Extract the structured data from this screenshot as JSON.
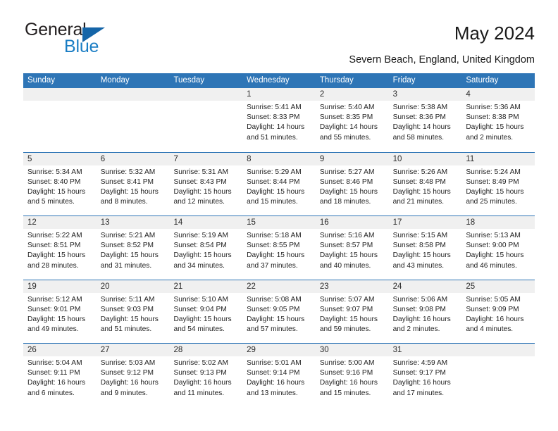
{
  "brand": {
    "name_top": "General",
    "name_bottom": "Blue",
    "accent_color": "#1a7dc4",
    "triangle_color": "#1565a8"
  },
  "header": {
    "title": "May 2024",
    "subtitle": "Severn Beach, England, United Kingdom"
  },
  "theme": {
    "header_blue": "#2e75b6",
    "daynum_band": "#f0f0f0",
    "text": "#222222"
  },
  "calendar": {
    "weekdays": [
      "Sunday",
      "Monday",
      "Tuesday",
      "Wednesday",
      "Thursday",
      "Friday",
      "Saturday"
    ],
    "weeks": [
      [
        {
          "day": "",
          "empty": true,
          "sunrise": "",
          "sunset": "",
          "daylight_line1": "",
          "daylight_line2": ""
        },
        {
          "day": "",
          "empty": true,
          "sunrise": "",
          "sunset": "",
          "daylight_line1": "",
          "daylight_line2": ""
        },
        {
          "day": "",
          "empty": true,
          "sunrise": "",
          "sunset": "",
          "daylight_line1": "",
          "daylight_line2": ""
        },
        {
          "day": "1",
          "empty": false,
          "sunrise": "Sunrise: 5:41 AM",
          "sunset": "Sunset: 8:33 PM",
          "daylight_line1": "Daylight: 14 hours",
          "daylight_line2": "and 51 minutes."
        },
        {
          "day": "2",
          "empty": false,
          "sunrise": "Sunrise: 5:40 AM",
          "sunset": "Sunset: 8:35 PM",
          "daylight_line1": "Daylight: 14 hours",
          "daylight_line2": "and 55 minutes."
        },
        {
          "day": "3",
          "empty": false,
          "sunrise": "Sunrise: 5:38 AM",
          "sunset": "Sunset: 8:36 PM",
          "daylight_line1": "Daylight: 14 hours",
          "daylight_line2": "and 58 minutes."
        },
        {
          "day": "4",
          "empty": false,
          "sunrise": "Sunrise: 5:36 AM",
          "sunset": "Sunset: 8:38 PM",
          "daylight_line1": "Daylight: 15 hours",
          "daylight_line2": "and 2 minutes."
        }
      ],
      [
        {
          "day": "5",
          "empty": false,
          "sunrise": "Sunrise: 5:34 AM",
          "sunset": "Sunset: 8:40 PM",
          "daylight_line1": "Daylight: 15 hours",
          "daylight_line2": "and 5 minutes."
        },
        {
          "day": "6",
          "empty": false,
          "sunrise": "Sunrise: 5:32 AM",
          "sunset": "Sunset: 8:41 PM",
          "daylight_line1": "Daylight: 15 hours",
          "daylight_line2": "and 8 minutes."
        },
        {
          "day": "7",
          "empty": false,
          "sunrise": "Sunrise: 5:31 AM",
          "sunset": "Sunset: 8:43 PM",
          "daylight_line1": "Daylight: 15 hours",
          "daylight_line2": "and 12 minutes."
        },
        {
          "day": "8",
          "empty": false,
          "sunrise": "Sunrise: 5:29 AM",
          "sunset": "Sunset: 8:44 PM",
          "daylight_line1": "Daylight: 15 hours",
          "daylight_line2": "and 15 minutes."
        },
        {
          "day": "9",
          "empty": false,
          "sunrise": "Sunrise: 5:27 AM",
          "sunset": "Sunset: 8:46 PM",
          "daylight_line1": "Daylight: 15 hours",
          "daylight_line2": "and 18 minutes."
        },
        {
          "day": "10",
          "empty": false,
          "sunrise": "Sunrise: 5:26 AM",
          "sunset": "Sunset: 8:48 PM",
          "daylight_line1": "Daylight: 15 hours",
          "daylight_line2": "and 21 minutes."
        },
        {
          "day": "11",
          "empty": false,
          "sunrise": "Sunrise: 5:24 AM",
          "sunset": "Sunset: 8:49 PM",
          "daylight_line1": "Daylight: 15 hours",
          "daylight_line2": "and 25 minutes."
        }
      ],
      [
        {
          "day": "12",
          "empty": false,
          "sunrise": "Sunrise: 5:22 AM",
          "sunset": "Sunset: 8:51 PM",
          "daylight_line1": "Daylight: 15 hours",
          "daylight_line2": "and 28 minutes."
        },
        {
          "day": "13",
          "empty": false,
          "sunrise": "Sunrise: 5:21 AM",
          "sunset": "Sunset: 8:52 PM",
          "daylight_line1": "Daylight: 15 hours",
          "daylight_line2": "and 31 minutes."
        },
        {
          "day": "14",
          "empty": false,
          "sunrise": "Sunrise: 5:19 AM",
          "sunset": "Sunset: 8:54 PM",
          "daylight_line1": "Daylight: 15 hours",
          "daylight_line2": "and 34 minutes."
        },
        {
          "day": "15",
          "empty": false,
          "sunrise": "Sunrise: 5:18 AM",
          "sunset": "Sunset: 8:55 PM",
          "daylight_line1": "Daylight: 15 hours",
          "daylight_line2": "and 37 minutes."
        },
        {
          "day": "16",
          "empty": false,
          "sunrise": "Sunrise: 5:16 AM",
          "sunset": "Sunset: 8:57 PM",
          "daylight_line1": "Daylight: 15 hours",
          "daylight_line2": "and 40 minutes."
        },
        {
          "day": "17",
          "empty": false,
          "sunrise": "Sunrise: 5:15 AM",
          "sunset": "Sunset: 8:58 PM",
          "daylight_line1": "Daylight: 15 hours",
          "daylight_line2": "and 43 minutes."
        },
        {
          "day": "18",
          "empty": false,
          "sunrise": "Sunrise: 5:13 AM",
          "sunset": "Sunset: 9:00 PM",
          "daylight_line1": "Daylight: 15 hours",
          "daylight_line2": "and 46 minutes."
        }
      ],
      [
        {
          "day": "19",
          "empty": false,
          "sunrise": "Sunrise: 5:12 AM",
          "sunset": "Sunset: 9:01 PM",
          "daylight_line1": "Daylight: 15 hours",
          "daylight_line2": "and 49 minutes."
        },
        {
          "day": "20",
          "empty": false,
          "sunrise": "Sunrise: 5:11 AM",
          "sunset": "Sunset: 9:03 PM",
          "daylight_line1": "Daylight: 15 hours",
          "daylight_line2": "and 51 minutes."
        },
        {
          "day": "21",
          "empty": false,
          "sunrise": "Sunrise: 5:10 AM",
          "sunset": "Sunset: 9:04 PM",
          "daylight_line1": "Daylight: 15 hours",
          "daylight_line2": "and 54 minutes."
        },
        {
          "day": "22",
          "empty": false,
          "sunrise": "Sunrise: 5:08 AM",
          "sunset": "Sunset: 9:05 PM",
          "daylight_line1": "Daylight: 15 hours",
          "daylight_line2": "and 57 minutes."
        },
        {
          "day": "23",
          "empty": false,
          "sunrise": "Sunrise: 5:07 AM",
          "sunset": "Sunset: 9:07 PM",
          "daylight_line1": "Daylight: 15 hours",
          "daylight_line2": "and 59 minutes."
        },
        {
          "day": "24",
          "empty": false,
          "sunrise": "Sunrise: 5:06 AM",
          "sunset": "Sunset: 9:08 PM",
          "daylight_line1": "Daylight: 16 hours",
          "daylight_line2": "and 2 minutes."
        },
        {
          "day": "25",
          "empty": false,
          "sunrise": "Sunrise: 5:05 AM",
          "sunset": "Sunset: 9:09 PM",
          "daylight_line1": "Daylight: 16 hours",
          "daylight_line2": "and 4 minutes."
        }
      ],
      [
        {
          "day": "26",
          "empty": false,
          "sunrise": "Sunrise: 5:04 AM",
          "sunset": "Sunset: 9:11 PM",
          "daylight_line1": "Daylight: 16 hours",
          "daylight_line2": "and 6 minutes."
        },
        {
          "day": "27",
          "empty": false,
          "sunrise": "Sunrise: 5:03 AM",
          "sunset": "Sunset: 9:12 PM",
          "daylight_line1": "Daylight: 16 hours",
          "daylight_line2": "and 9 minutes."
        },
        {
          "day": "28",
          "empty": false,
          "sunrise": "Sunrise: 5:02 AM",
          "sunset": "Sunset: 9:13 PM",
          "daylight_line1": "Daylight: 16 hours",
          "daylight_line2": "and 11 minutes."
        },
        {
          "day": "29",
          "empty": false,
          "sunrise": "Sunrise: 5:01 AM",
          "sunset": "Sunset: 9:14 PM",
          "daylight_line1": "Daylight: 16 hours",
          "daylight_line2": "and 13 minutes."
        },
        {
          "day": "30",
          "empty": false,
          "sunrise": "Sunrise: 5:00 AM",
          "sunset": "Sunset: 9:16 PM",
          "daylight_line1": "Daylight: 16 hours",
          "daylight_line2": "and 15 minutes."
        },
        {
          "day": "31",
          "empty": false,
          "sunrise": "Sunrise: 4:59 AM",
          "sunset": "Sunset: 9:17 PM",
          "daylight_line1": "Daylight: 16 hours",
          "daylight_line2": "and 17 minutes."
        },
        {
          "day": "",
          "empty": true,
          "sunrise": "",
          "sunset": "",
          "daylight_line1": "",
          "daylight_line2": ""
        }
      ]
    ]
  }
}
